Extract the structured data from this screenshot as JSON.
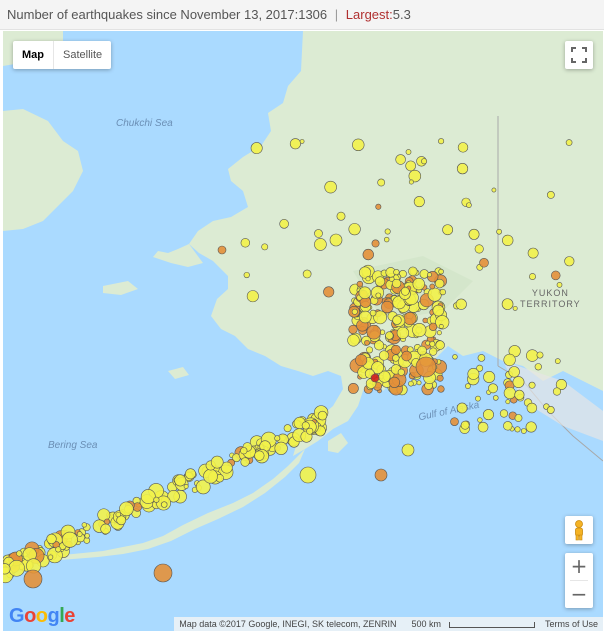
{
  "header": {
    "count_label": "Number of earthquakes since November 13, 2017:",
    "count_value": "1306",
    "separator": "|",
    "largest_label": "Largest:",
    "largest_value": "5.3"
  },
  "map": {
    "type_buttons": [
      "Map",
      "Satellite"
    ],
    "active_type": "Map",
    "labels": {
      "chukchi_sea": "Chukchi Sea",
      "bering_sea": "Bering Sea",
      "gulf_of_alaska": "Gulf of Alaska",
      "yukon_line1": "YUKON",
      "yukon_line2": "TERRITORY"
    },
    "zoom_in": "+",
    "zoom_out": "−",
    "google_logo": "Google",
    "attribution": "Map data ©2017 Google, INEGI, SK telecom, ZENRIN",
    "scale": "500 km",
    "terms": "Terms of Use",
    "colors": {
      "water": "#aadaff",
      "land": "#dcebd3",
      "small_quake": "#f2f24a",
      "medium_quake": "#e3903a",
      "largest_quake": "#d02020"
    },
    "icons": [
      "fullscreen-icon",
      "pegman-icon"
    ]
  }
}
